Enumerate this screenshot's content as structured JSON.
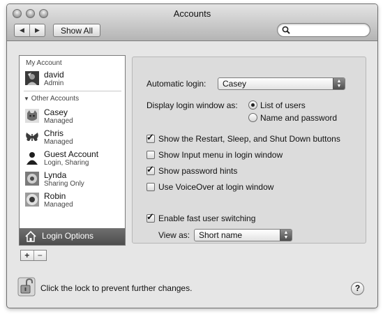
{
  "window": {
    "title": "Accounts",
    "toolbar": {
      "back_label": "◀",
      "forward_label": "▶",
      "show_all_label": "Show All",
      "search_placeholder": ""
    }
  },
  "sidebar": {
    "my_account_header": "My Account",
    "my_account": {
      "name": "david",
      "role": "Admin"
    },
    "other_accounts_header": "Other Accounts",
    "accounts": [
      {
        "name": "Casey",
        "role": "Managed",
        "icon": "cat-icon"
      },
      {
        "name": "Chris",
        "role": "Managed",
        "icon": "butterfly-icon"
      },
      {
        "name": "Guest Account",
        "role": "Login, Sharing",
        "icon": "person-silhouette-icon"
      },
      {
        "name": "Lynda",
        "role": "Sharing Only",
        "icon": "flower-icon"
      },
      {
        "name": "Robin",
        "role": "Managed",
        "icon": "sunflower-icon"
      }
    ],
    "login_options_label": "Login Options",
    "add_label": "+",
    "remove_label": "−"
  },
  "login_panel": {
    "automatic_login_label": "Automatic login:",
    "automatic_login_value": "Casey",
    "display_as_label": "Display login window as:",
    "display_options": [
      "List of users",
      "Name and password"
    ],
    "display_selected": "List of users",
    "checkboxes": [
      {
        "label": "Show the Restart, Sleep, and Shut Down buttons",
        "checked": true
      },
      {
        "label": "Show Input menu in login window",
        "checked": false
      },
      {
        "label": "Show password hints",
        "checked": true
      },
      {
        "label": "Use VoiceOver at login window",
        "checked": false
      }
    ],
    "fast_switching": {
      "label": "Enable fast user switching",
      "checked": true
    },
    "view_as_label": "View as:",
    "view_as_value": "Short name"
  },
  "footer": {
    "lock_text": "Click the lock to prevent further changes.",
    "help_label": "?"
  }
}
